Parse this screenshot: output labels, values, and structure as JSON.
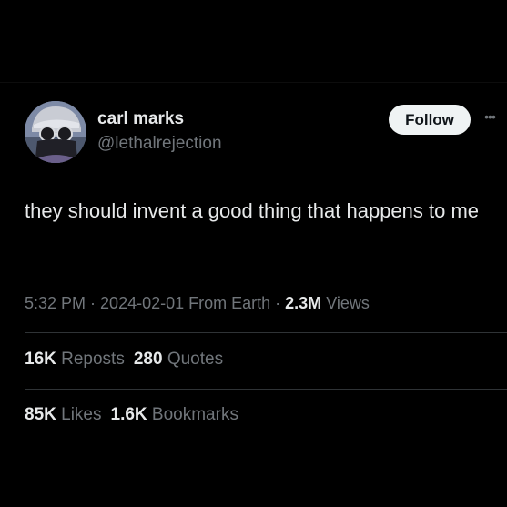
{
  "author": {
    "display_name": "carl marks",
    "handle": "@lethalrejection",
    "avatar_icon": "profile-photo"
  },
  "actions": {
    "follow_label": "Follow",
    "more_label": "•••"
  },
  "tweet": {
    "text": "they should invent a good thing that happens to me"
  },
  "meta": {
    "time": "5:32 PM",
    "separator_1": " · ",
    "date": "2024-02-01",
    "source": " From Earth",
    "separator_2": " · ",
    "views_count": "2.3M",
    "views_label": " Views"
  },
  "engagement": {
    "reposts_count": "16K",
    "reposts_label": " Reposts",
    "quotes_count": "280",
    "quotes_label": " Quotes",
    "likes_count": "85K",
    "likes_label": " Likes",
    "bookmarks_count": "1.6K",
    "bookmarks_label": " Bookmarks"
  },
  "colors": {
    "background": "#000000",
    "primary_text": "#e7e9ea",
    "secondary_text": "#71767b",
    "divider": "#2f3336",
    "follow_button_bg": "#eff3f4"
  }
}
